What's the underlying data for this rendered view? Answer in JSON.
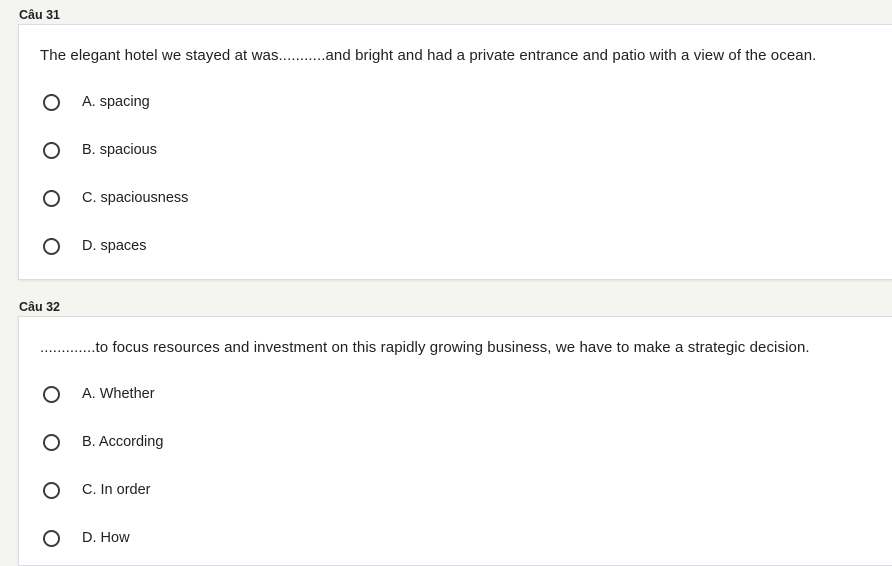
{
  "questions": [
    {
      "title": "Câu 31",
      "text": "The elegant hotel we stayed at was...........and bright and had a private entrance and patio with a view of the ocean.",
      "options": [
        {
          "label": "A. spacing"
        },
        {
          "label": "B. spacious"
        },
        {
          "label": "C. spaciousness"
        },
        {
          "label": "D. spaces"
        }
      ]
    },
    {
      "title": "Câu 32",
      "text": ".............to focus resources and investment on this rapidly growing business, we have to make a strategic decision.",
      "options": [
        {
          "label": "A. Whether"
        },
        {
          "label": "B. According"
        },
        {
          "label": "C. In order"
        },
        {
          "label": "D. How"
        }
      ]
    }
  ]
}
